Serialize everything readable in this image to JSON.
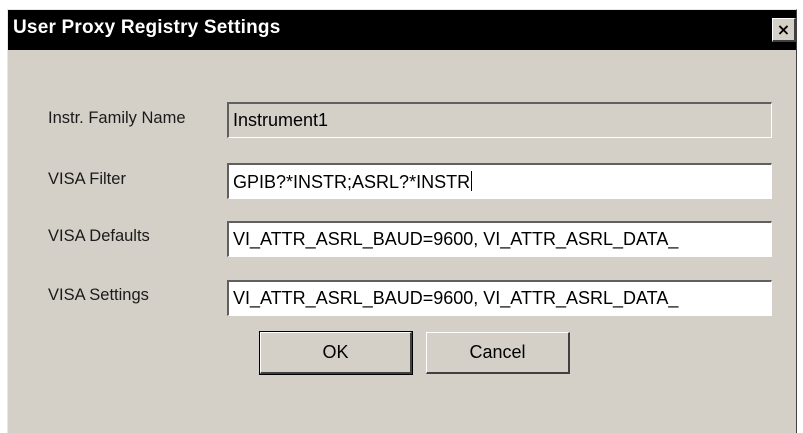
{
  "window": {
    "title": "User Proxy Registry Settings",
    "close_glyph": "×"
  },
  "form": {
    "family_name": {
      "label": "Instr. Family Name",
      "value": "Instrument1"
    },
    "visa_filter": {
      "label": "VISA Filter",
      "value": "GPIB?*INSTR;ASRL?*INSTR"
    },
    "visa_defaults": {
      "label": "VISA Defaults",
      "value": "VI_ATTR_ASRL_BAUD=9600, VI_ATTR_ASRL_DATA_"
    },
    "visa_settings": {
      "label": "VISA Settings",
      "value": "VI_ATTR_ASRL_BAUD=9600, VI_ATTR_ASRL_DATA_"
    }
  },
  "buttons": {
    "ok_label": "OK",
    "cancel_label": "Cancel"
  }
}
